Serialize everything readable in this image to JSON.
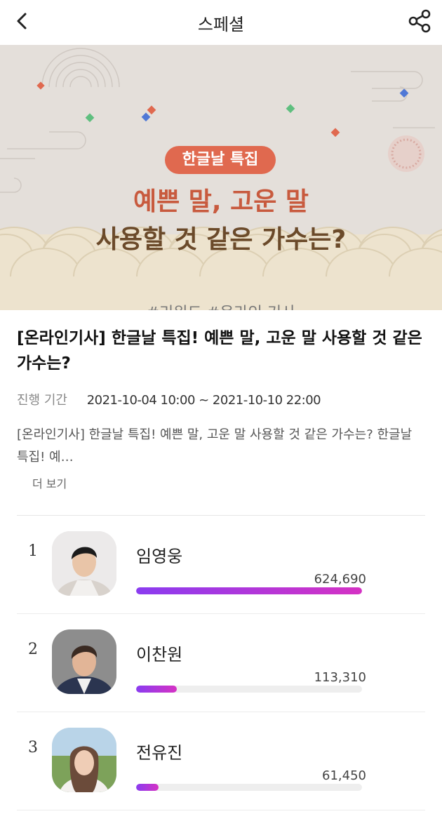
{
  "header": {
    "title": "스페셜",
    "back_icon": "chevron-left-icon",
    "share_icon": "share-icon"
  },
  "banner": {
    "badge": "한글날 특집",
    "headline_line1": "예쁜 말, 고운 말",
    "headline_line2": "사용할 것 같은 가수는?",
    "tags": "#리워드 #온라인 기사",
    "colors": {
      "accent": "#e0694f",
      "headline1": "#c85a3e",
      "headline2": "#6b4a2a",
      "background": "#e4dfda",
      "wave": "#ede3ce"
    }
  },
  "article": {
    "title": "[온라인기사] 한글날 특집! 예쁜 말, 고운 말 사용할 것 같은 가수는?",
    "period_label": "진행 기간",
    "period_value": "2021-10-04 10:00 ~ 2021-10-10 22:00",
    "description": "[온라인기사] 한글날 특집! 예쁜 말, 고운 말 사용할 것 같은 가수는? 한글날 특집! 예…",
    "more_label": "더 보기"
  },
  "ranking": [
    {
      "rank": "1",
      "name": "임영웅",
      "votes": "624,690",
      "fraction": 1.0
    },
    {
      "rank": "2",
      "name": "이찬원",
      "votes": "113,310",
      "fraction": 0.18
    },
    {
      "rank": "3",
      "name": "전유진",
      "votes": "61,450",
      "fraction": 0.1
    }
  ]
}
